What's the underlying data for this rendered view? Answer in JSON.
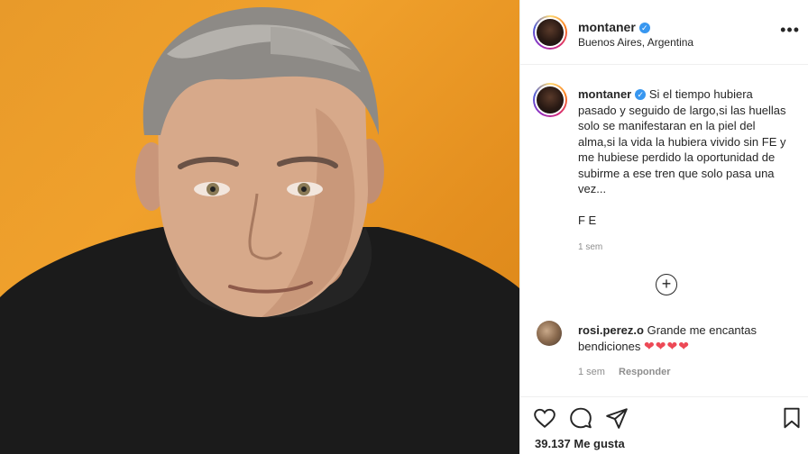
{
  "post": {
    "username": "montaner",
    "location": "Buenos Aires, Argentina",
    "caption": "Si el tiempo hubiera pasado y seguido de largo,si las huellas solo se manifestaran en la piel del alma,si la vida la hubiera vivido sin FE y me hubiese perdido la oportunidad de subirme a ese tren que solo pasa una vez...\n\nF E",
    "caption_time": "1 sem",
    "likes": "39.137 Me gusta"
  },
  "comment": {
    "username": "rosi.perez.o",
    "text": "Grande me encantas bendiciones",
    "hearts": "❤❤❤❤",
    "time": "1 sem",
    "reply_label": "Responder"
  },
  "icons": {
    "more": "more-options-icon",
    "verified": "verified-badge-icon",
    "add": "add-comment-icon",
    "like": "heart-icon",
    "comment": "comment-icon",
    "share": "share-icon",
    "save": "bookmark-icon"
  },
  "colors": {
    "background_photo": "#e89a2a",
    "verified": "#3897f0",
    "heart": "#ed4956",
    "muted_text": "#8e8e8e"
  }
}
